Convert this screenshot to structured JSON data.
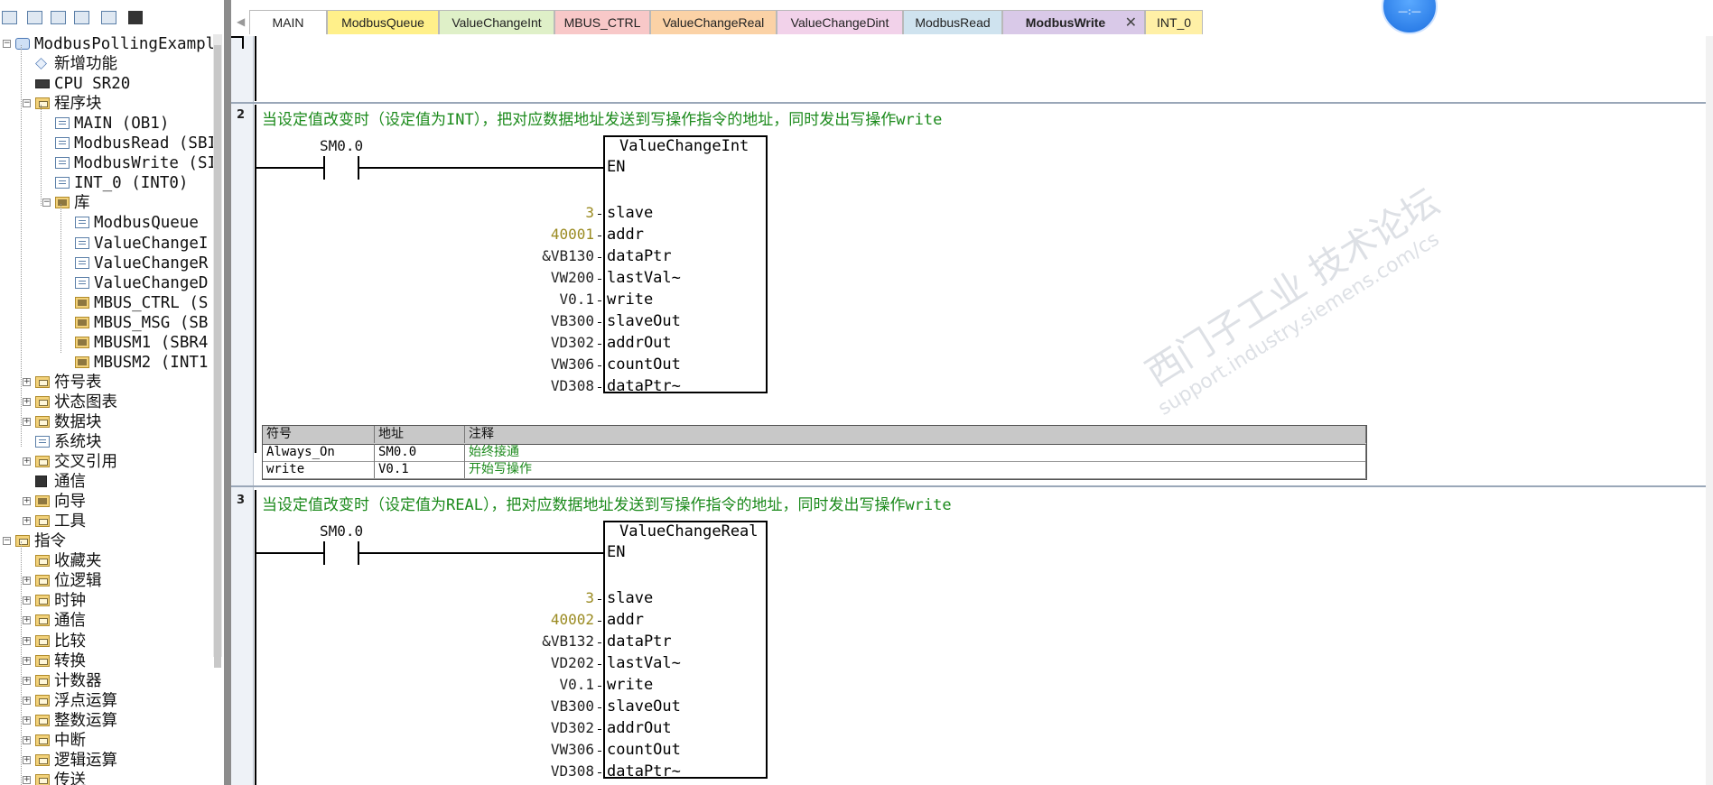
{
  "left_tree": {
    "items": [
      {
        "label": "ModbusPollingExampl",
        "icon": "project-icon"
      },
      {
        "label": "新增功能",
        "icon": "new-features-icon"
      },
      {
        "label": "CPU SR20",
        "icon": "cpu-icon"
      },
      {
        "label": "程序块",
        "icon": "folder-icon"
      },
      {
        "label": "MAIN (OB1)",
        "icon": "program-icon"
      },
      {
        "label": "ModbusRead (SBI",
        "icon": "program-icon"
      },
      {
        "label": "ModbusWrite (SI",
        "icon": "program-icon"
      },
      {
        "label": "INT_0 (INT0)",
        "icon": "program-icon"
      },
      {
        "label": "库",
        "icon": "library-folder-icon"
      },
      {
        "label": "ModbusQueue",
        "icon": "program-icon"
      },
      {
        "label": "ValueChangeI",
        "icon": "program-icon"
      },
      {
        "label": "ValueChangeR",
        "icon": "program-icon"
      },
      {
        "label": "ValueChangeD",
        "icon": "program-icon"
      },
      {
        "label": "MBUS_CTRL (S",
        "icon": "library-block-icon"
      },
      {
        "label": "MBUS_MSG (SB",
        "icon": "library-block-icon"
      },
      {
        "label": "MBUSM1 (SBR4",
        "icon": "library-block-icon"
      },
      {
        "label": "MBUSM2 (INT1",
        "icon": "library-block-icon"
      },
      {
        "label": "符号表",
        "icon": "folder-icon"
      },
      {
        "label": "状态图表",
        "icon": "folder-icon"
      },
      {
        "label": "数据块",
        "icon": "folder-icon"
      },
      {
        "label": "系统块",
        "icon": "system-block-icon"
      },
      {
        "label": "交叉引用",
        "icon": "folder-icon"
      },
      {
        "label": "通信",
        "icon": "communication-icon"
      },
      {
        "label": "向导",
        "icon": "folder-icon"
      },
      {
        "label": "工具",
        "icon": "folder-icon"
      },
      {
        "label": "指令",
        "icon": "folder-icon"
      },
      {
        "label": "收藏夹",
        "icon": "folder-icon"
      },
      {
        "label": "位逻辑",
        "icon": "folder-icon"
      },
      {
        "label": "时钟",
        "icon": "folder-icon"
      },
      {
        "label": "通信",
        "icon": "folder-icon"
      },
      {
        "label": "比较",
        "icon": "folder-icon"
      },
      {
        "label": "转换",
        "icon": "folder-icon"
      },
      {
        "label": "计数器",
        "icon": "folder-icon"
      },
      {
        "label": "浮点运算",
        "icon": "folder-icon"
      },
      {
        "label": "整数运算",
        "icon": "folder-icon"
      },
      {
        "label": "中断",
        "icon": "folder-icon"
      },
      {
        "label": "逻辑运算",
        "icon": "folder-icon"
      },
      {
        "label": "传送",
        "icon": "folder-icon"
      }
    ]
  },
  "tabs": [
    {
      "label": "MAIN",
      "color": "#ffffff"
    },
    {
      "label": "ModbusQueue",
      "color": "#fff08a"
    },
    {
      "label": "ValueChangeInt",
      "color": "#dff0c8"
    },
    {
      "label": "MBUS_CTRL",
      "color": "#f8c8c8"
    },
    {
      "label": "ValueChangeReal",
      "color": "#fbd2a6"
    },
    {
      "label": "ValueChangeDint",
      "color": "#f2d2ea"
    },
    {
      "label": "ModbusRead",
      "color": "#cfe3ef"
    },
    {
      "label": "ModbusWrite",
      "color": "#d9c9e8",
      "active": true,
      "close": "✕"
    },
    {
      "label": "INT_0",
      "color": "#fff0a6"
    }
  ],
  "networks": [
    {
      "number": "2",
      "comment": "当设定值改变时（设定值为INT），把对应数据地址发送到写操作指令的地址，同时发出写操作write",
      "contact": "SM0.0",
      "block_title": "ValueChangeInt",
      "en_label": "EN",
      "pins": [
        {
          "operand": "3",
          "const": true,
          "name": "slave"
        },
        {
          "operand": "40001",
          "const": true,
          "name": "addr"
        },
        {
          "operand": "&VB130",
          "const": false,
          "name": "dataPtr"
        },
        {
          "operand": "VW200",
          "const": false,
          "name": "lastVal~"
        },
        {
          "operand": "V0.1",
          "const": false,
          "name": "write"
        },
        {
          "operand": "VB300",
          "const": false,
          "name": "slaveOut"
        },
        {
          "operand": "VD302",
          "const": false,
          "name": "addrOut"
        },
        {
          "operand": "VW306",
          "const": false,
          "name": "countOut"
        },
        {
          "operand": "VD308",
          "const": false,
          "name": "dataPtr~"
        }
      ],
      "symbol_table": {
        "headers": [
          "符号",
          "地址",
          "注释"
        ],
        "rows": [
          [
            "Always_On",
            "SM0.0",
            "始终接通"
          ],
          [
            "write",
            "V0.1",
            "开始写操作"
          ]
        ]
      }
    },
    {
      "number": "3",
      "comment": "当设定值改变时（设定值为REAL），把对应数据地址发送到写操作指令的地址，同时发出写操作write",
      "contact": "SM0.0",
      "block_title": "ValueChangeReal",
      "en_label": "EN",
      "pins": [
        {
          "operand": "3",
          "const": true,
          "name": "slave"
        },
        {
          "operand": "40002",
          "const": true,
          "name": "addr"
        },
        {
          "operand": "&VB132",
          "const": false,
          "name": "dataPtr"
        },
        {
          "operand": "VD202",
          "const": false,
          "name": "lastVal~"
        },
        {
          "operand": "V0.1",
          "const": false,
          "name": "write"
        },
        {
          "operand": "VB300",
          "const": false,
          "name": "slaveOut"
        },
        {
          "operand": "VD302",
          "const": false,
          "name": "addrOut"
        },
        {
          "operand": "VW306",
          "const": false,
          "name": "countOut"
        },
        {
          "operand": "VD308",
          "const": false,
          "name": "dataPtr~"
        }
      ]
    }
  ],
  "watermark": {
    "line1": "西门子工业  技术论坛",
    "line2": "support.industry.siemens.com/cs"
  },
  "round_button": "—:—"
}
